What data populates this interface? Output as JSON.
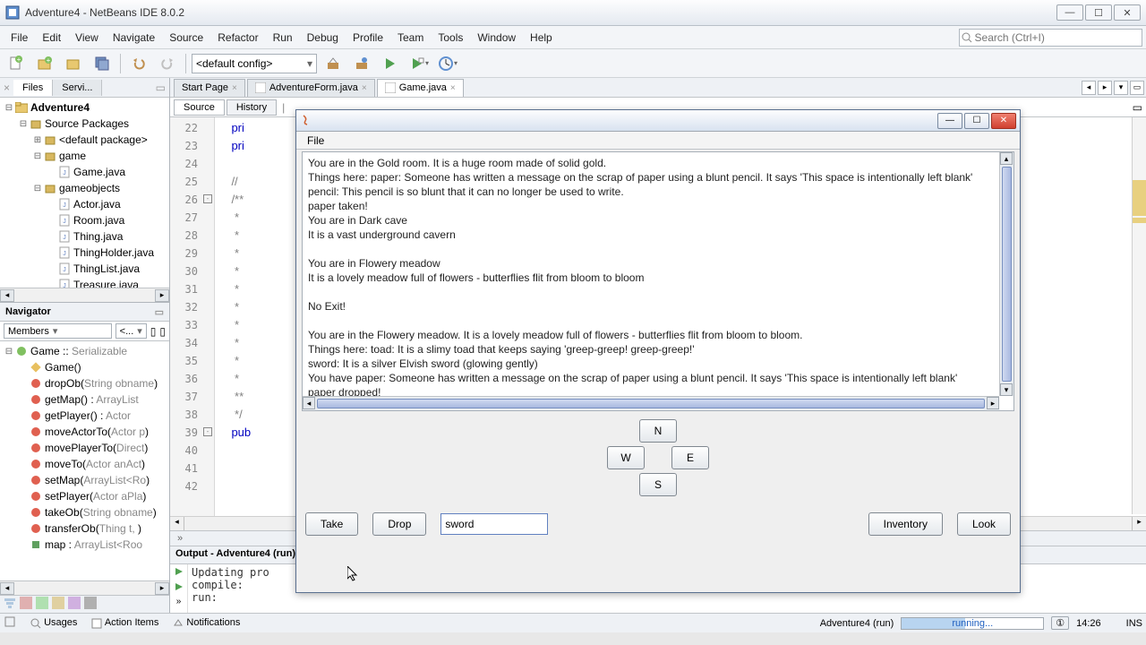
{
  "window": {
    "title": "Adventure4 - NetBeans IDE 8.0.2"
  },
  "menu": [
    "File",
    "Edit",
    "View",
    "Navigate",
    "Source",
    "Refactor",
    "Run",
    "Debug",
    "Profile",
    "Team",
    "Tools",
    "Window",
    "Help"
  ],
  "search_placeholder": "Search (Ctrl+I)",
  "toolbar": {
    "config": "<default config>"
  },
  "leftpanel": {
    "tabs": [
      "Files",
      "Servi..."
    ],
    "tree": [
      {
        "indent": 0,
        "exp": "⊟",
        "icon": "project",
        "label": "Adventure4",
        "bold": true
      },
      {
        "indent": 1,
        "exp": "⊟",
        "icon": "pkg",
        "label": "Source Packages"
      },
      {
        "indent": 2,
        "exp": "⊞",
        "icon": "pkg",
        "label": "<default package>"
      },
      {
        "indent": 2,
        "exp": "⊟",
        "icon": "pkg",
        "label": "game"
      },
      {
        "indent": 3,
        "exp": "",
        "icon": "java",
        "label": "Game.java"
      },
      {
        "indent": 2,
        "exp": "⊟",
        "icon": "pkg",
        "label": "gameobjects"
      },
      {
        "indent": 3,
        "exp": "",
        "icon": "java",
        "label": "Actor.java"
      },
      {
        "indent": 3,
        "exp": "",
        "icon": "java",
        "label": "Room.java"
      },
      {
        "indent": 3,
        "exp": "",
        "icon": "java",
        "label": "Thing.java"
      },
      {
        "indent": 3,
        "exp": "",
        "icon": "java",
        "label": "ThingHolder.java"
      },
      {
        "indent": 3,
        "exp": "",
        "icon": "java",
        "label": "ThingList.java"
      },
      {
        "indent": 3,
        "exp": "",
        "icon": "java",
        "label": "Treasure.java"
      }
    ],
    "nav_title": "Navigator",
    "nav_combo1": "Members",
    "nav_combo2": "<...",
    "members_root": "Game :: Serializable",
    "members": [
      {
        "icon": "ctor",
        "label": "Game()"
      },
      {
        "icon": "method",
        "html": "dropOb(<span style='color:#888'>String obname</span>)"
      },
      {
        "icon": "method",
        "html": "getMap() : <span style='color:#888'>ArrayList</span>"
      },
      {
        "icon": "method",
        "html": "getPlayer() : <span style='color:#888'>Actor</span>"
      },
      {
        "icon": "method",
        "html": "moveActorTo(<span style='color:#888'>Actor p</span>)"
      },
      {
        "icon": "method",
        "html": "movePlayerTo(<span style='color:#888'>Direct</span>)"
      },
      {
        "icon": "method",
        "html": "moveTo(<span style='color:#888'>Actor anAct</span>)"
      },
      {
        "icon": "method",
        "html": "setMap(<span style='color:#888'>ArrayList&lt;Ro</span>)"
      },
      {
        "icon": "method",
        "html": "setPlayer(<span style='color:#888'>Actor aPla</span>)"
      },
      {
        "icon": "method",
        "html": "takeOb(<span style='color:#888'>String obname</span>)"
      },
      {
        "icon": "method",
        "html": "transferOb(<span style='color:#888'>Thing t, </span>)"
      },
      {
        "icon": "field",
        "html": "map : <span style='color:#888'>ArrayList&lt;Roo</span>"
      }
    ]
  },
  "editor": {
    "tabs": [
      {
        "label": "Start Page",
        "active": false
      },
      {
        "label": "AdventureForm.java",
        "active": false
      },
      {
        "label": "Game.java",
        "active": true
      }
    ],
    "src_tabs": [
      "Source",
      "History"
    ],
    "lines": [
      22,
      23,
      24,
      25,
      26,
      27,
      28,
      29,
      30,
      31,
      32,
      33,
      34,
      35,
      36,
      37,
      38,
      39,
      40,
      41,
      42
    ],
    "code": [
      {
        "t": "    pri",
        "cls": "kw"
      },
      {
        "t": "    pri",
        "cls": "kw"
      },
      {
        "t": "",
        "cls": ""
      },
      {
        "t": "    //",
        "cls": "cm"
      },
      {
        "t": "    /**",
        "cls": "cm"
      },
      {
        "t": "     *",
        "cls": "cm"
      },
      {
        "t": "     *",
        "cls": "cm"
      },
      {
        "t": "     *",
        "cls": "cm"
      },
      {
        "t": "     *",
        "cls": "cm"
      },
      {
        "t": "     *",
        "cls": "cm"
      },
      {
        "t": "     *",
        "cls": "cm"
      },
      {
        "t": "     *",
        "cls": "cm"
      },
      {
        "t": "     *",
        "cls": "cm"
      },
      {
        "t": "     *",
        "cls": "cm"
      },
      {
        "t": "     *",
        "cls": "cm"
      },
      {
        "t": "     **",
        "cls": "cm"
      },
      {
        "t": "     */",
        "cls": "cm"
      },
      {
        "t": "    pub",
        "cls": "kw"
      },
      {
        "t": "",
        "cls": ""
      },
      {
        "t": "",
        "cls": ""
      },
      {
        "t": "",
        "cls": ""
      }
    ]
  },
  "output": {
    "title": "Output - Adventure4 (run)",
    "lines": [
      "Updating pro",
      "compile:",
      "run:"
    ]
  },
  "game": {
    "menu": "File",
    "text": "You are in the Gold room. It is a huge room made of solid gold.\nThings here: paper: Someone has written a message on the scrap of paper using a blunt pencil. It says 'This space is intentionally left blank'\npencil: This pencil is so blunt that it can no longer be used to write.\npaper taken!\nYou are in Dark cave\nIt is a vast underground cavern\n\nYou are in Flowery meadow\nIt is a lovely meadow full of flowers - butterflies flit from bloom to bloom\n\nNo Exit!\n\nYou are in the Flowery meadow. It is a lovely meadow full of flowers - butterflies flit from bloom to bloom.\nThings here: toad: It is a slimy toad that keeps saying 'greep-greep! greep-greep!'\nsword: It is a silver Elvish sword (glowing gently)\nYou have paper: Someone has written a message on the scrap of paper using a blunt pencil. It says 'This space is intentionally left blank'\npaper dropped!",
    "nav": {
      "n": "N",
      "s": "S",
      "e": "E",
      "w": "W"
    },
    "buttons": {
      "take": "Take",
      "drop": "Drop",
      "inventory": "Inventory",
      "look": "Look"
    },
    "input": "sword"
  },
  "status": {
    "usages": "Usages",
    "actionitems": "Action Items",
    "notifications": "Notifications",
    "task": "Adventure4 (run)",
    "progress": "running...",
    "time": "14:26",
    "ins": "INS"
  }
}
